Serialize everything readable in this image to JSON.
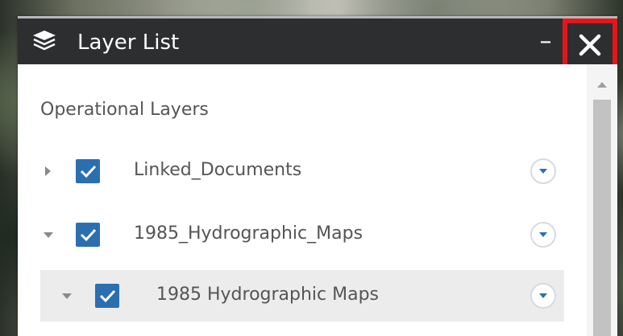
{
  "panel": {
    "title": "Layer List",
    "title_icon": "layers-icon",
    "minimize_label": "–",
    "close_icon": "close-icon"
  },
  "section": {
    "label": "Operational Layers"
  },
  "layers": [
    {
      "label": "Linked_Documents",
      "expanded": false,
      "checked": true
    },
    {
      "label": "1985_Hydrographic_Maps",
      "expanded": true,
      "checked": true
    },
    {
      "label": "1985 Hydrographic Maps",
      "expanded": true,
      "checked": true,
      "sublayer": true
    }
  ],
  "colors": {
    "titlebar": "#2d2e30",
    "checkbox": "#2c6fb0",
    "close_highlight": "#e4161b",
    "text": "#555555"
  }
}
